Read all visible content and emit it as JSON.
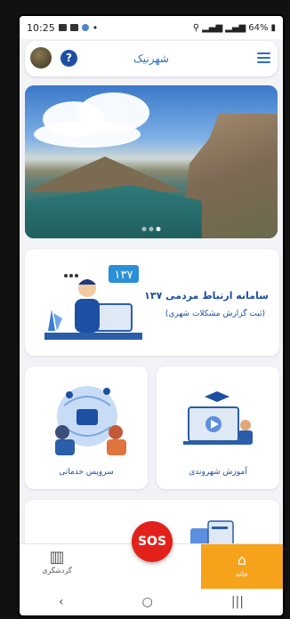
{
  "status": {
    "time": "10:25",
    "battery": "64%"
  },
  "header": {
    "title": "شهرنیک",
    "help_label": "?"
  },
  "cards": {
    "main_title": "سامانه ارتباط مردمی ۱۳۷",
    "main_subtitle": "(ثبت گزارش مشکلات شهری)",
    "main_badge": "۱۳۷",
    "left_label": "سرویس خدماتی",
    "right_label": "آموزش شهروندی"
  },
  "sos_label": "SOS",
  "nav": {
    "tour_label": "گردشگری",
    "home_label": "خانه"
  },
  "sysnav": {
    "back": "‹",
    "home": "○",
    "recent": "|||"
  },
  "colors": {
    "accent": "#2a6dc4",
    "primary_dark": "#1d4fa3",
    "home_active": "#f7a21b",
    "sos": "#e3211c"
  }
}
